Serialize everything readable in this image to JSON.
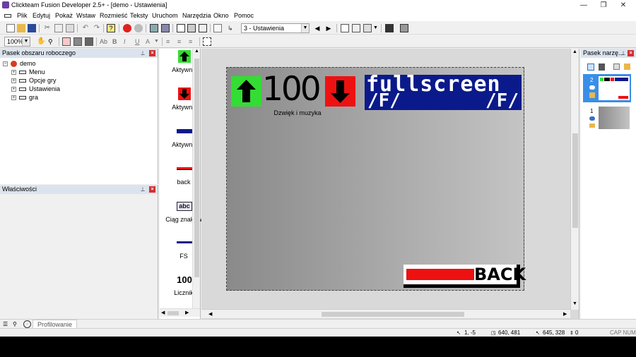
{
  "window": {
    "title": "Clickteam Fusion Developer 2.5+ - [demo - Ustawienia]",
    "minimize": "—",
    "restore": "❐",
    "close": "✕"
  },
  "menu": [
    "Plik",
    "Edytuj",
    "Pokaż",
    "Wstaw",
    "Rozmieść",
    "Teksty",
    "Uruchom",
    "Narzędzia",
    "Okno",
    "Pomoc"
  ],
  "toolbar": {
    "frame_select": "3 - Ustawienia",
    "zoom": "100%"
  },
  "workspace": {
    "title": "Pasek obszaru roboczego",
    "root": "demo",
    "items": [
      "Menu",
      "Opcje gry",
      "Ustawienia",
      "gra"
    ]
  },
  "properties": {
    "title": "Właściwości"
  },
  "objects": {
    "labels": [
      "Aktywny",
      "Aktywny",
      "Aktywny",
      "back",
      "Ciąg znaków",
      "FS",
      "Licznik"
    ],
    "counter_icon": "100",
    "string_icon": "abc"
  },
  "frame": {
    "counter_value": "100",
    "counter_caption": "Dzwięk i muzyka",
    "fullscreen_text": "fullscreen",
    "fs_line2_left": "/F/",
    "fs_line2_right": "/F/",
    "back_text": "BACK"
  },
  "layers": {
    "title": "Pasek narzę...",
    "layer_numbers": [
      "2",
      "1"
    ]
  },
  "bottom_tabs": {
    "profiling": "Profilowanie"
  },
  "status": {
    "coord1": "1, -5",
    "coord2": "640, 481",
    "coord3": "645, 328",
    "coord4": "0",
    "caps": "CAP NUM"
  },
  "colors": {
    "green": "#33dd33",
    "red": "#ee1111",
    "navy": "#0b1a8a",
    "panel": "#f0f0f0",
    "header": "#dbe4ee"
  }
}
